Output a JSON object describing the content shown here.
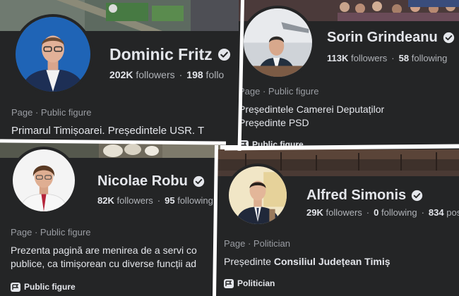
{
  "colors": {
    "panel_bg": "#242526",
    "primary_text": "#e4e6eb",
    "secondary_text": "#b0b3b8",
    "gutter": "#ffffff"
  },
  "profiles": [
    {
      "name": "Dominic Fritz",
      "verified": true,
      "followers_count": "202K",
      "followers_label": "followers",
      "following_count": "198",
      "following_label": "follo",
      "separator": "·",
      "meta": "Page · Public figure",
      "bio_line1": "Primarul Timișoarei. Președintele USR. T"
    },
    {
      "name": "Sorin Grindeanu",
      "verified": true,
      "followers_count": "113K",
      "followers_label": "followers",
      "following_count": "58",
      "following_label": "following",
      "separator": "·",
      "meta": "Page · Public figure",
      "bio_line1": "Președintele Camerei Deputaților",
      "bio_line2": "Președinte PSD",
      "category": "Public figure",
      "category_icon": "page-flag-icon"
    },
    {
      "name": "Nicolae Robu",
      "verified": true,
      "followers_count": "82K",
      "followers_label": "followers",
      "following_count": "95",
      "following_label": "following",
      "separator": "·",
      "meta": "Page · Public figure",
      "bio_line1": "Prezenta pagină are menirea de a servi co",
      "bio_line2": "publice, ca timișorean cu diverse funcții ad",
      "category": "Public figure",
      "category_icon": "page-flag-icon"
    },
    {
      "name": "Alfred Simonis",
      "verified": true,
      "followers_count": "29K",
      "followers_label": "followers",
      "following_count": "0",
      "following_label": "following",
      "posts_count": "834",
      "posts_label": "post",
      "separator": "·",
      "meta": "Page · Politician",
      "bio_prefix": "Președinte ",
      "bio_bold": "Consiliul Județean Timiș",
      "category": "Politician",
      "category_icon": "page-flag-icon"
    }
  ]
}
